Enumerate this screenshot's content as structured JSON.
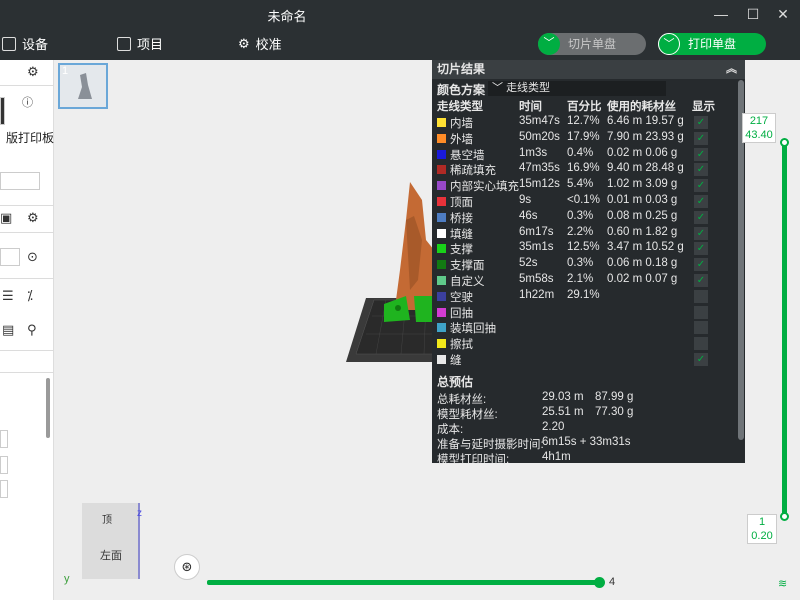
{
  "window": {
    "title": "未命名",
    "controls": [
      "—",
      "☐",
      "✕"
    ]
  },
  "toolbar": {
    "device_label": "设备",
    "project_label": "项目",
    "calibration_label": "校准",
    "slice_button": "切片单盘",
    "print_button": "打印单盘"
  },
  "left_panel": {
    "plate_label": "版打印板"
  },
  "plate": {
    "index": "1"
  },
  "results": {
    "title": "切片结果",
    "color_scheme_label": "颜色方案",
    "color_scheme_value": "走线类型",
    "columns": [
      "走线类型",
      "时间",
      "百分比",
      "使用的耗材丝",
      "显示"
    ],
    "rows": [
      {
        "name": "内墙",
        "color": "#ffe033",
        "time": "35m47s",
        "pct": "12.7%",
        "usage": "6.46 m  19.57 g",
        "shown": true
      },
      {
        "name": "外墙",
        "color": "#ff8c27",
        "time": "50m20s",
        "pct": "17.9%",
        "usage": "7.90 m  23.93 g",
        "shown": true
      },
      {
        "name": "悬空墙",
        "color": "#1a1adc",
        "time": "1m3s",
        "pct": "0.4%",
        "usage": "0.02 m  0.06 g",
        "shown": true
      },
      {
        "name": "稀疏填充",
        "color": "#b02a25",
        "time": "47m35s",
        "pct": "16.9%",
        "usage": "9.40 m  28.48 g",
        "shown": true
      },
      {
        "name": "内部实心填充",
        "color": "#9748c9",
        "time": "15m12s",
        "pct": "5.4%",
        "usage": "1.02 m  3.09 g",
        "shown": true
      },
      {
        "name": "顶面",
        "color": "#e8323a",
        "time": "9s",
        "pct": "<0.1%",
        "usage": "0.01 m  0.03 g",
        "shown": true
      },
      {
        "name": "桥接",
        "color": "#4e7dc2",
        "time": "46s",
        "pct": "0.3%",
        "usage": "0.08 m  0.25 g",
        "shown": true
      },
      {
        "name": "填缝",
        "color": "#ffffff",
        "time": "6m17s",
        "pct": "2.2%",
        "usage": "0.60 m  1.82 g",
        "shown": true
      },
      {
        "name": "支撑",
        "color": "#19d219",
        "time": "35m1s",
        "pct": "12.5%",
        "usage": "3.47 m  10.52 g",
        "shown": true
      },
      {
        "name": "支撑面",
        "color": "#127a12",
        "time": "52s",
        "pct": "0.3%",
        "usage": "0.06 m  0.18 g",
        "shown": true
      },
      {
        "name": "自定义",
        "color": "#5fc98a",
        "time": "5m58s",
        "pct": "2.1%",
        "usage": "0.02 m  0.07 g",
        "shown": true
      },
      {
        "name": "空驶",
        "color": "#3b3f9e",
        "time": "1h22m",
        "pct": "29.1%",
        "usage": "",
        "shown": false
      },
      {
        "name": "回抽",
        "color": "#d33cd3",
        "time": "",
        "pct": "",
        "usage": "",
        "shown": false
      },
      {
        "name": "装填回抽",
        "color": "#3fa3c8",
        "time": "",
        "pct": "",
        "usage": "",
        "shown": false
      },
      {
        "name": "擦拭",
        "color": "#f2e81a",
        "time": "",
        "pct": "",
        "usage": "",
        "shown": false
      },
      {
        "name": "缝",
        "color": "#e8e8e8",
        "time": "",
        "pct": "",
        "usage": "",
        "shown": true
      }
    ],
    "summary_title": "总预估",
    "summary": [
      {
        "key": "总耗材丝:",
        "v1": "29.03 m",
        "v2": "87.99 g"
      },
      {
        "key": "模型耗材丝:",
        "v1": "25.51 m",
        "v2": "77.30 g"
      },
      {
        "key": "成本:",
        "v1": "2.20",
        "v2": ""
      },
      {
        "key": "准备与延时摄影时间:",
        "v1": "6m15s + 33m31s",
        "v2": ""
      },
      {
        "key": "模型打印时间:",
        "v1": "4h1m",
        "v2": ""
      }
    ]
  },
  "layer_slider": {
    "top_layer": "217",
    "top_height": "43.40",
    "bottom_layer": "1",
    "bottom_height": "0.20",
    "top_fraction": 1.0,
    "bottom_fraction": 0.0
  },
  "move_slider": {
    "value": "4"
  },
  "view_cube": {
    "top_label": "顶",
    "face_label": "左面",
    "axis_z": "z",
    "axis_y": "y"
  },
  "colors": {
    "accent": "#00ae42",
    "panel_bg": "#262a2d",
    "titlebar_bg": "#2b3033"
  }
}
